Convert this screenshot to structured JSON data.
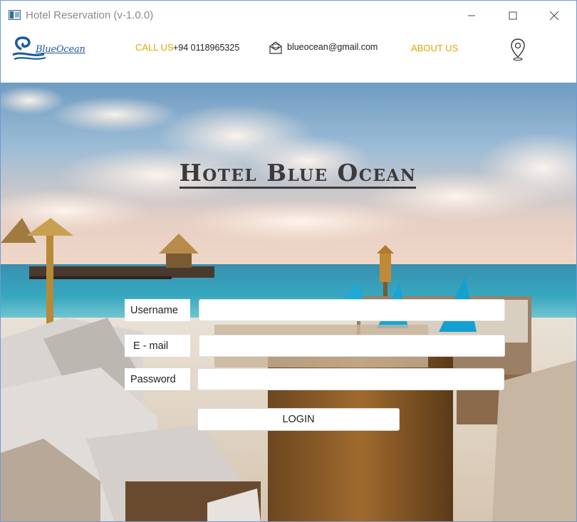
{
  "window": {
    "title": "Hotel Reservation (v-1.0.0)"
  },
  "header": {
    "logo_text": "BlueOcean",
    "call_label": "CALL US",
    "phone": "+94 0118965325",
    "email": "blueocean@gmail.com",
    "about_label": "ABOUT US",
    "accent_color": "#e2a500",
    "icons": {
      "mail": "envelope-icon",
      "location": "map-pin-icon"
    }
  },
  "main": {
    "hotel_title": "Hotel Blue Ocean"
  },
  "form": {
    "username_label": "Username",
    "email_label": "E - mail",
    "password_label": "Password",
    "username_value": "",
    "email_value": "",
    "password_value": "",
    "login_label": "LOGIN"
  }
}
